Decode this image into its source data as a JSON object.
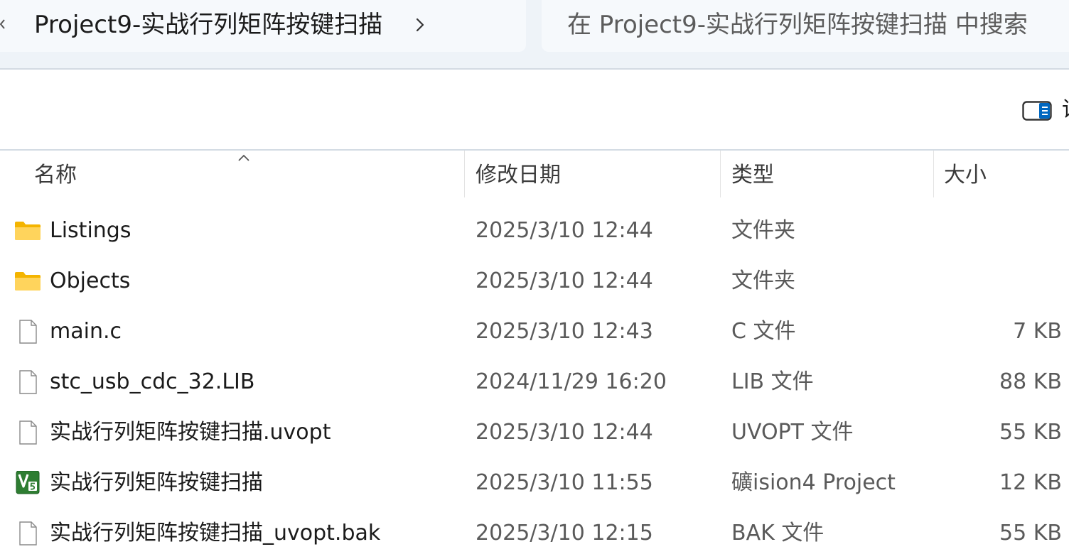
{
  "breadcrumb": {
    "path": "Project9-实战行列矩阵按键扫描"
  },
  "search": {
    "placeholder": "在 Project9-实战行列矩阵按键扫描 中搜索"
  },
  "toolbar": {
    "details_label": "详"
  },
  "columns": {
    "name": "名称",
    "date": "修改日期",
    "type": "类型",
    "size": "大小"
  },
  "files": [
    {
      "name": "Listings",
      "date": "2025/3/10 12:44",
      "type": "文件夹",
      "size": "",
      "icon": "folder-icon"
    },
    {
      "name": "Objects",
      "date": "2025/3/10 12:44",
      "type": "文件夹",
      "size": "",
      "icon": "folder-icon"
    },
    {
      "name": "main.c",
      "date": "2025/3/10 12:43",
      "type": "C 文件",
      "size": "7 KB",
      "icon": "file-icon"
    },
    {
      "name": "stc_usb_cdc_32.LIB",
      "date": "2024/11/29 16:20",
      "type": "LIB 文件",
      "size": "88 KB",
      "icon": "file-icon"
    },
    {
      "name": "实战行列矩阵按键扫描.uvopt",
      "date": "2025/3/10 12:44",
      "type": "UVOPT 文件",
      "size": "55 KB",
      "icon": "file-icon"
    },
    {
      "name": "实战行列矩阵按键扫描",
      "date": "2025/3/10 11:55",
      "type": "礦ision4 Project",
      "size": "12 KB",
      "icon": "keil-uvision-icon"
    },
    {
      "name": "实战行列矩阵按键扫描_uvopt.bak",
      "date": "2025/3/10 12:15",
      "type": "BAK 文件",
      "size": "55 KB",
      "icon": "file-icon"
    }
  ],
  "colors": {
    "folder": "#f8c13a",
    "keil": "#2e7d32",
    "accent": "#0067c0"
  }
}
